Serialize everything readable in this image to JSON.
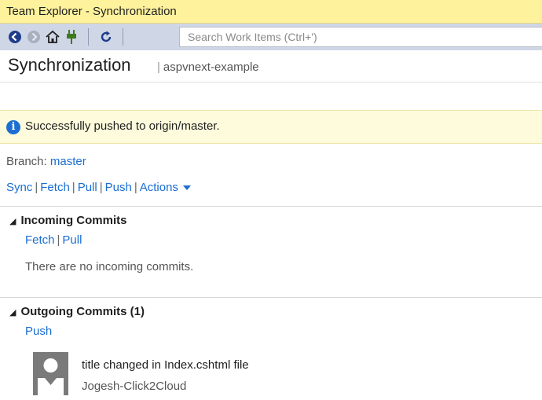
{
  "window": {
    "title": "Team Explorer - Synchronization"
  },
  "toolbar": {
    "search_placeholder": "Search Work Items (Ctrl+')",
    "icons": [
      "back-icon",
      "forward-icon",
      "home-icon",
      "connect-icon",
      "refresh-icon"
    ]
  },
  "header": {
    "title": "Synchronization",
    "separator": "|",
    "repo": "aspvnext-example"
  },
  "info": {
    "message": "Successfully pushed to origin/master.",
    "icon": "info-icon"
  },
  "branch": {
    "label": "Branch:",
    "name": "master"
  },
  "actions": {
    "sync": "Sync",
    "fetch": "Fetch",
    "pull": "Pull",
    "push": "Push",
    "actions": "Actions"
  },
  "incoming": {
    "title": "Incoming Commits",
    "fetch": "Fetch",
    "pull": "Pull",
    "empty": "There are no incoming commits."
  },
  "outgoing": {
    "title": "Outgoing Commits (1)",
    "push": "Push",
    "commits": [
      {
        "title": "title changed in Index.cshtml file",
        "author": "Jogesh-Click2Cloud"
      }
    ]
  },
  "colors": {
    "accent": "#1a6ed1",
    "title_bar": "#fff29d",
    "info_bar": "#fdfbdc",
    "toolbar": "#cfd6e5"
  }
}
